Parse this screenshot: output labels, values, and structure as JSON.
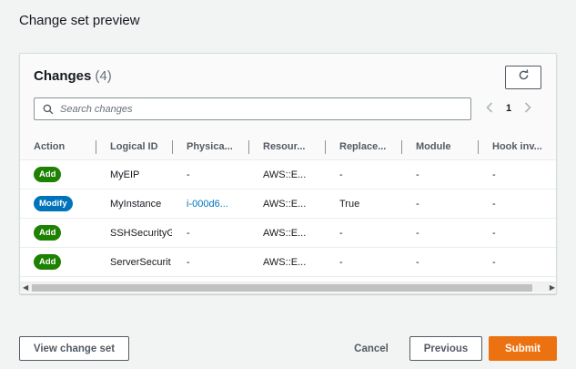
{
  "page": {
    "title": "Change set preview"
  },
  "changes": {
    "title": "Changes",
    "count": "(4)",
    "search_placeholder": "Search changes",
    "search_value": "",
    "page_number": "1",
    "columns": [
      "Action",
      "Logical ID",
      "Physica...",
      "Resour...",
      "Replace...",
      "Module",
      "Hook inv..."
    ],
    "rows": [
      {
        "action": "Add",
        "action_type": "add",
        "logical_id": "MyEIP",
        "physical_id": "-",
        "resource": "AWS::E...",
        "replacement": "-",
        "module": "-",
        "hook": "-"
      },
      {
        "action": "Modify",
        "action_type": "modify",
        "logical_id": "MyInstance",
        "physical_id": "i-000d6...",
        "resource": "AWS::E...",
        "replacement": "True",
        "module": "-",
        "hook": "-"
      },
      {
        "action": "Add",
        "action_type": "add",
        "logical_id": "SSHSecurityG",
        "physical_id": "-",
        "resource": "AWS::E...",
        "replacement": "-",
        "module": "-",
        "hook": "-"
      },
      {
        "action": "Add",
        "action_type": "add",
        "logical_id": "ServerSecurit",
        "physical_id": "-",
        "resource": "AWS::E...",
        "replacement": "-",
        "module": "-",
        "hook": "-"
      }
    ]
  },
  "footer": {
    "view_label": "View change set",
    "cancel_label": "Cancel",
    "previous_label": "Previous",
    "submit_label": "Submit"
  },
  "icons": {
    "refresh": "refresh-icon",
    "search": "search-icon",
    "prev_page": "chevron-left-icon",
    "next_page": "chevron-right-icon"
  },
  "colors": {
    "add_badge": "#1d8102",
    "modify_badge": "#0073bb",
    "link": "#0073bb",
    "primary_button": "#ec7211"
  }
}
